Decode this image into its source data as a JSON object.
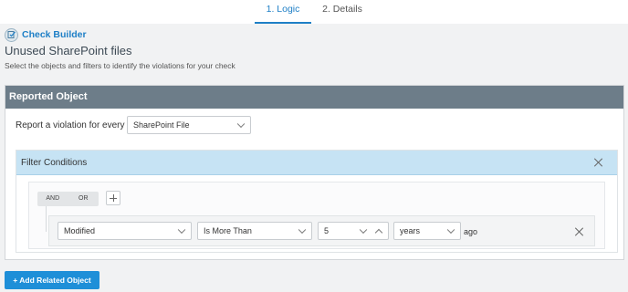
{
  "tabs": [
    {
      "label": "1. Logic",
      "active": true
    },
    {
      "label": "2. Details",
      "active": false
    }
  ],
  "header": {
    "builder_label": "Check Builder",
    "builder_icon": "check-builder-icon",
    "title": "Unused SharePoint files",
    "subtitle": "Select the objects and filters to identify the violations for your check"
  },
  "reported_object": {
    "header": "Reported Object",
    "report_label": "Report a violation for every",
    "object_select_value": "SharePoint File"
  },
  "filter_conditions": {
    "header": "Filter Conditions",
    "and_label": "AND",
    "or_label": "OR",
    "condition": {
      "field": "Modified",
      "operator": "Is More Than",
      "amount": "5",
      "unit": "years",
      "suffix": "ago"
    }
  },
  "add_related_label": "+ Add Related Object",
  "colors": {
    "accent": "#1e7fc6",
    "card_header": "#6d7d89",
    "filter_header": "#c6e3f4",
    "button": "#1e8fd8"
  }
}
